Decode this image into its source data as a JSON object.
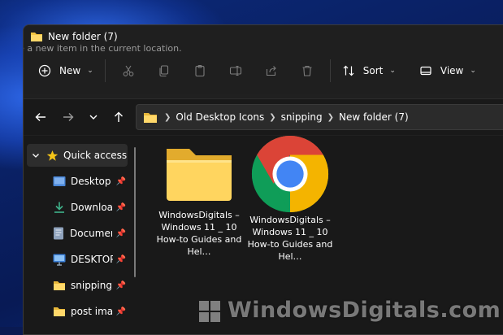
{
  "window": {
    "title": "New folder (7)"
  },
  "tooltip_ghost": "reate a new item in the current location.",
  "toolbar": {
    "new_label": "New",
    "sort_label": "Sort",
    "view_label": "View"
  },
  "address": {
    "crumbs": [
      "Old Desktop Icons",
      "snipping",
      "New folder (7)"
    ]
  },
  "sidebar": {
    "items": [
      {
        "label": "Quick access"
      },
      {
        "label": "Desktop"
      },
      {
        "label": "Downloads"
      },
      {
        "label": "Documents"
      },
      {
        "label": "DESKTOP-"
      },
      {
        "label": "snipping"
      },
      {
        "label": "post images"
      }
    ]
  },
  "files": [
    {
      "name": "WindowsDigitals – Windows 11 _ 10 How-to Guides and Hel…"
    },
    {
      "name": "WindowsDigitals – Windows 11 _ 10 How-to Guides and Hel…"
    }
  ],
  "watermark": {
    "text": "WindowsDigitals.com"
  },
  "colors": {
    "folder_yellow": "#f4c542",
    "chrome_red": "#db4437",
    "chrome_green": "#0f9d58",
    "chrome_yellow": "#f4b400",
    "chrome_blue": "#4285f4"
  }
}
